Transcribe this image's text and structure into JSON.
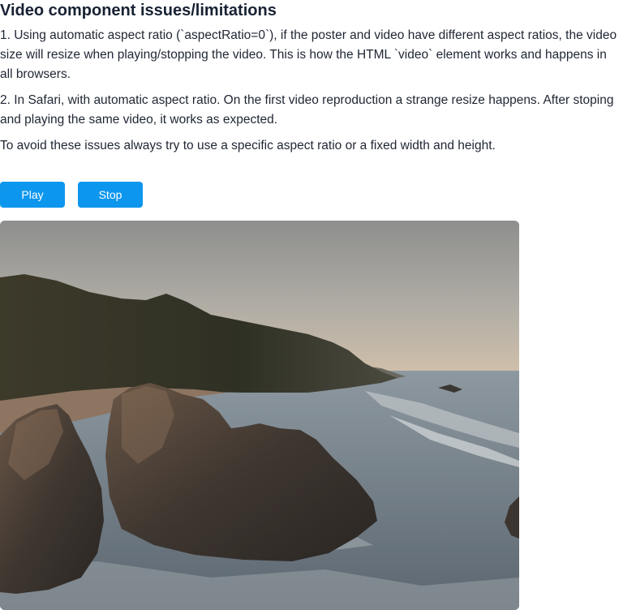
{
  "heading": "Video component issues/limitations",
  "paragraphs": {
    "issue1": "1. Using automatic aspect ratio (`aspectRatio=0`), if the poster and video have different aspect ratios, the video size will resize when playing/stopping the video. This is how the HTML `video` element works and happens in all browsers.",
    "issue2": "2. In Safari, with automatic aspect ratio. On the first video reproduction a strange resize happens. After stoping and playing the same video, it works as expected.",
    "advice": "To avoid these issues always try to use a specific aspect ratio or a fixed width and height."
  },
  "controls": {
    "play_label": "Play",
    "stop_label": "Stop"
  },
  "video": {
    "poster_alt": "Aerial view of rocky coastline with waves at dusk"
  },
  "colors": {
    "accent": "#0d96ee",
    "heading": "#182234",
    "text": "#1f2633"
  }
}
